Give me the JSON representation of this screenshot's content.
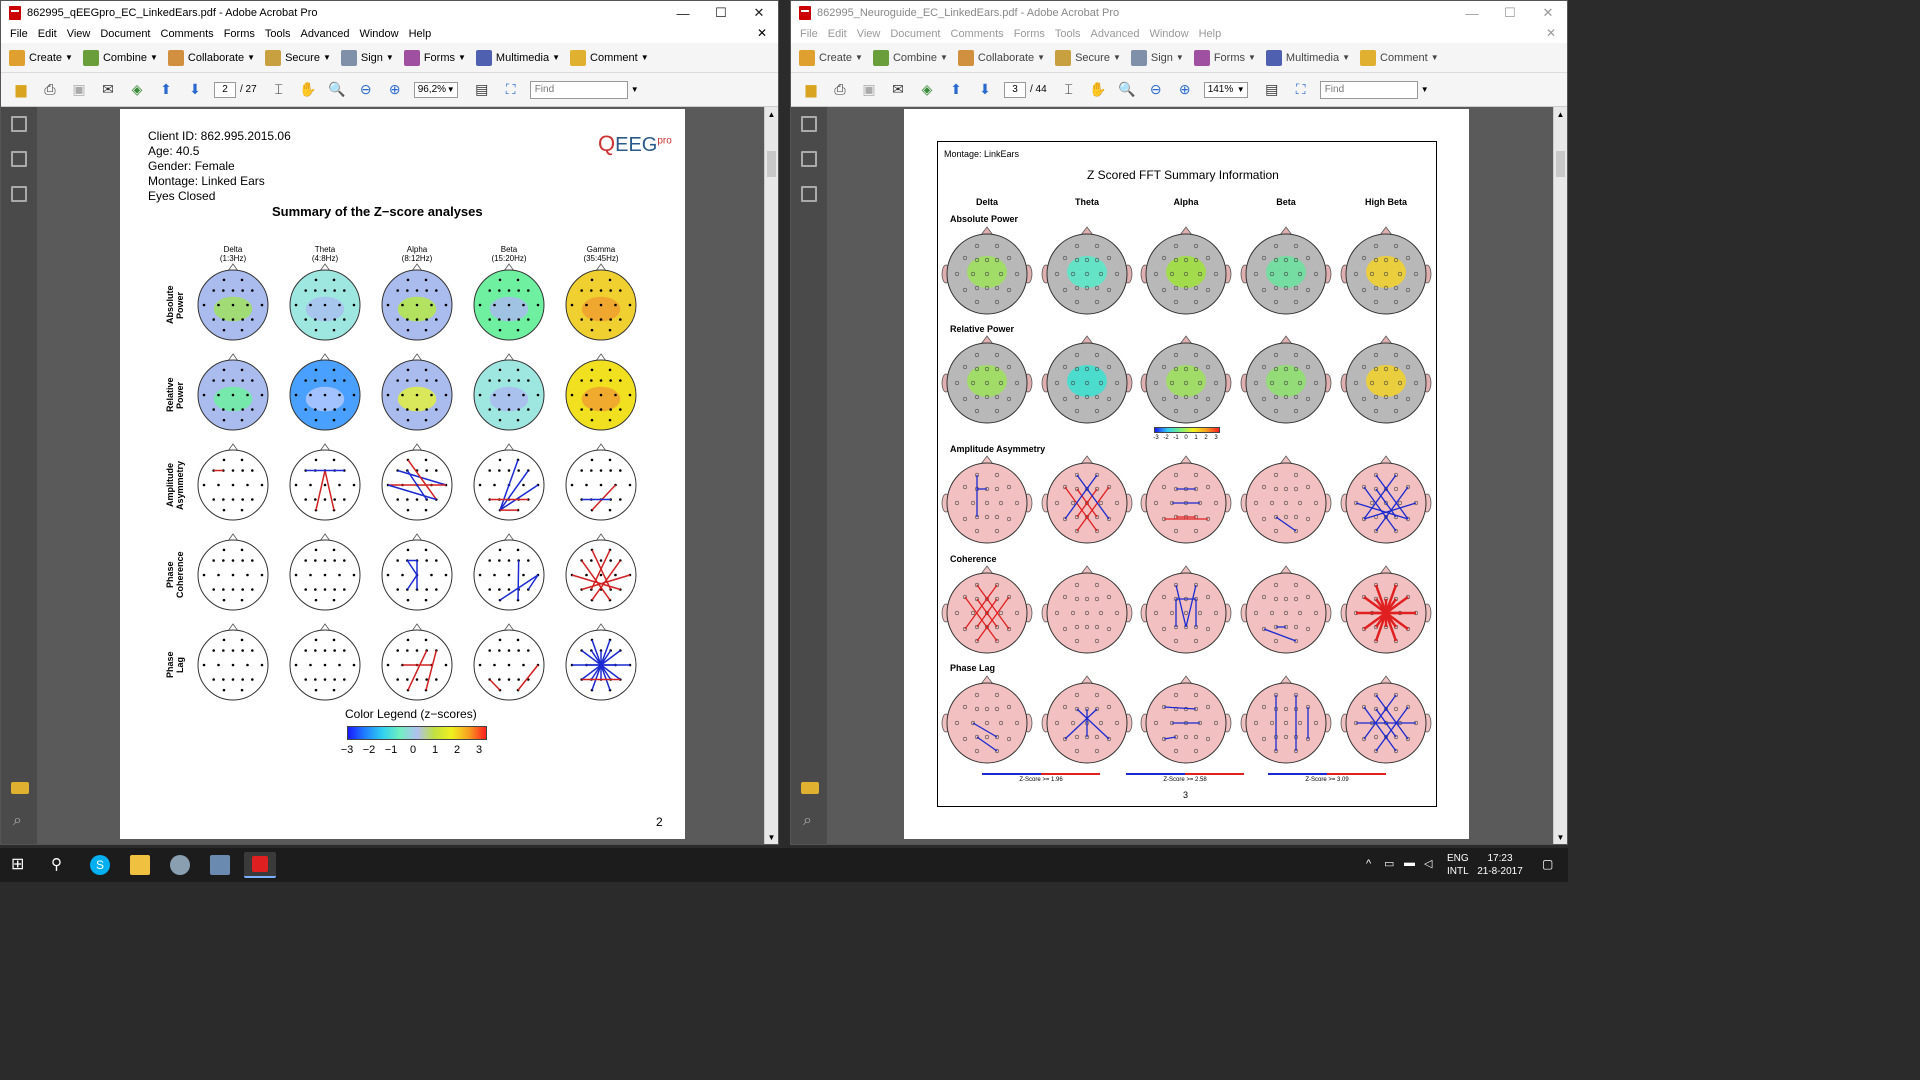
{
  "left_window": {
    "title": "862995_qEEGpro_EC_LinkedEars.pdf - Adobe Acrobat Pro",
    "menu": [
      "File",
      "Edit",
      "View",
      "Document",
      "Comments",
      "Forms",
      "Tools",
      "Advanced",
      "Window",
      "Help"
    ],
    "tools": [
      "Create",
      "Combine",
      "Collaborate",
      "Secure",
      "Sign",
      "Forms",
      "Multimedia",
      "Comment"
    ],
    "page_current": "2",
    "page_total": "/ 27",
    "zoom": "96,2%",
    "find_placeholder": "Find",
    "document": {
      "client_id": "Client ID: 862.995.2015.06",
      "age": "Age: 40.5",
      "gender": "Gender: Female",
      "montage": "Montage: Linked Ears",
      "condition": "Eyes Closed",
      "logo": "EEG",
      "logo_sup": "pro",
      "heading": "Summary of the Z−score analyses",
      "columns": [
        {
          "name": "Delta",
          "range": "(1:3Hz)"
        },
        {
          "name": "Theta",
          "range": "(4:8Hz)"
        },
        {
          "name": "Alpha",
          "range": "(8:12Hz)"
        },
        {
          "name": "Beta",
          "range": "(15:20Hz)"
        },
        {
          "name": "Gamma",
          "range": "(35:45Hz)"
        }
      ],
      "rows": [
        [
          "Absolute",
          "Power"
        ],
        [
          "Relative",
          "Power"
        ],
        [
          "Amplitude",
          "Asymmetry"
        ],
        [
          "Phase",
          "Coherence"
        ],
        [
          "Phase",
          "Lag"
        ]
      ],
      "legend_title": "Color Legend (z−scores)",
      "legend_ticks": [
        "−3",
        "−2",
        "−1",
        "0",
        "1",
        "2",
        "3"
      ],
      "page_number": "2"
    }
  },
  "right_window": {
    "title": "862995_Neuroguide_EC_LinkedEars.pdf - Adobe Acrobat Pro",
    "menu": [
      "File",
      "Edit",
      "View",
      "Document",
      "Comments",
      "Forms",
      "Tools",
      "Advanced",
      "Window",
      "Help"
    ],
    "tools": [
      "Create",
      "Combine",
      "Collaborate",
      "Secure",
      "Sign",
      "Forms",
      "Multimedia",
      "Comment"
    ],
    "page_current": "3",
    "page_total": "/ 44",
    "zoom": "141%",
    "find_placeholder": "Find",
    "document": {
      "montage": "Montage:  LinkEars",
      "heading": "Z Scored FFT Summary Information",
      "columns": [
        "Delta",
        "Theta",
        "Alpha",
        "Beta",
        "High Beta"
      ],
      "sections": [
        "Absolute Power",
        "Relative Power",
        "Amplitude Asymmetry",
        "Coherence",
        "Phase Lag"
      ],
      "scale_ticks": [
        "-3",
        "-2",
        "-1",
        "0",
        "1",
        "2",
        "3"
      ],
      "zscore_labels": [
        "Z-Score >= 1.96",
        "Z-Score >= 2.58",
        "Z-Score >= 3.09"
      ],
      "page_number": "3"
    }
  },
  "taskbar": {
    "lang": "ENG",
    "layout": "INTL",
    "time": "17:23",
    "date": "21-8-2017"
  }
}
